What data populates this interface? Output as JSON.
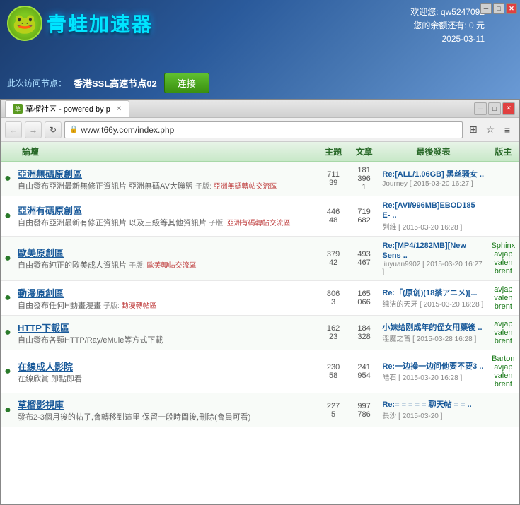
{
  "app": {
    "title": "青蛙加速器",
    "logo_emoji": "🐸",
    "welcome": "欢迎您: qw5247092",
    "balance": "您的余额还有: 0 元",
    "time": "2025-03-11",
    "node_label": "此次访问节点：",
    "node_value": "香港SSL高速节点02",
    "connect_label": "连接",
    "window_controls": {
      "minimize": "─",
      "maximize": "□",
      "close": "✕"
    }
  },
  "browser": {
    "tab_title": "草榴社区 - powered by p",
    "url": "www.t66y.com/index.php",
    "win_controls": {
      "minimize": "─",
      "maximize": "□",
      "close": "✕"
    }
  },
  "forum": {
    "header": {
      "col_forum": "論壇",
      "col_topics": "主題",
      "col_posts": "文章",
      "col_lastpost": "最後發表",
      "col_moderator": "版主"
    },
    "rows": [
      {
        "id": 1,
        "name": "亞洲無碼原創區",
        "desc": "自由發布亞洲最新無修正資訊片 亞洲無碼AV大聯盟",
        "sub": "亞洲無碼轉帖交流區",
        "topics": "711",
        "topics2": "39",
        "posts": "181",
        "posts2": "396",
        "posts3": "1",
        "last_title": "Re:[ALL/1.06GB] 黑丝骚女 ..",
        "last_author": "Journey",
        "last_time": "2015-03-20 16:27",
        "moderators": ""
      },
      {
        "id": 2,
        "name": "亞洲有碼原創區",
        "desc": "自由發布亞洲最新有修正資訊片 以及三級等其他資訊片",
        "sub": "亞洲有碼轉帖交流區",
        "topics": "446",
        "topics2": "48",
        "posts": "719",
        "posts2": "682",
        "posts3": "",
        "last_title": "Re:[AVI/996MB]EBOD185 E- ..",
        "last_author": "列維",
        "last_time": "2015-03-20 16:28",
        "moderators": ""
      },
      {
        "id": 3,
        "name": "歐美原創區",
        "desc": "自由發布純正的歐美成人資訊片",
        "sub": "歐美轉帖交流區",
        "topics": "379",
        "topics2": "42",
        "posts": "493",
        "posts2": "467",
        "posts3": "",
        "last_title": "Re:[MP4/1282MB][New Sens ..",
        "last_author": "liuyuan9902",
        "last_time": "2015-03-20 16:27",
        "moderators": "Sphinx avjap valen brent"
      },
      {
        "id": 4,
        "name": "動漫原創區",
        "desc": "自由發布任何H動畫漫畫",
        "sub": "動漫轉帖區",
        "topics": "806",
        "topics2": "3",
        "posts": "165",
        "posts2": "066",
        "posts3": "",
        "last_title": "Re:「(原创)(18禁アニメ)[...",
        "last_author": "纯洁的天牙",
        "last_time": "2015-03-20 16:28",
        "moderators": "avjap valen brent"
      },
      {
        "id": 5,
        "name": "HTTP下載區",
        "desc": "自由發布各類HTTP/Ray/eMule等方式下載",
        "sub": "",
        "topics": "162",
        "topics2": "23",
        "posts": "184",
        "posts2": "328",
        "posts3": "",
        "last_title": "小妹给刚成年的侄女用藥後 ..",
        "last_author": "淫魔之首",
        "last_time": "2015-03-28 16:28",
        "moderators": "avjap valen brent"
      },
      {
        "id": 6,
        "name": "在線成人影院",
        "desc": "在線欣賞,即點即看",
        "sub": "",
        "topics": "230",
        "topics2": "58",
        "posts": "241",
        "posts2": "954",
        "posts3": "",
        "last_title": "Re:一边操一边问他要不要3 ..",
        "last_author": "皓石",
        "last_time": "2015-03-20 16:28",
        "moderators": "Barton avjap valen brent"
      },
      {
        "id": 7,
        "name": "草榴影視庫",
        "desc": "發布2-3個月後的帖子,會轉移到這里,保留一段時間後,刪除(會員可看)",
        "sub": "",
        "topics": "227",
        "topics2": "5",
        "posts": "997",
        "posts2": "786",
        "posts3": "",
        "last_title": "Re:= = = = = 聊天帖 = = ..",
        "last_author": "長沙",
        "last_time": "2015-03-20",
        "moderators": ""
      }
    ]
  }
}
